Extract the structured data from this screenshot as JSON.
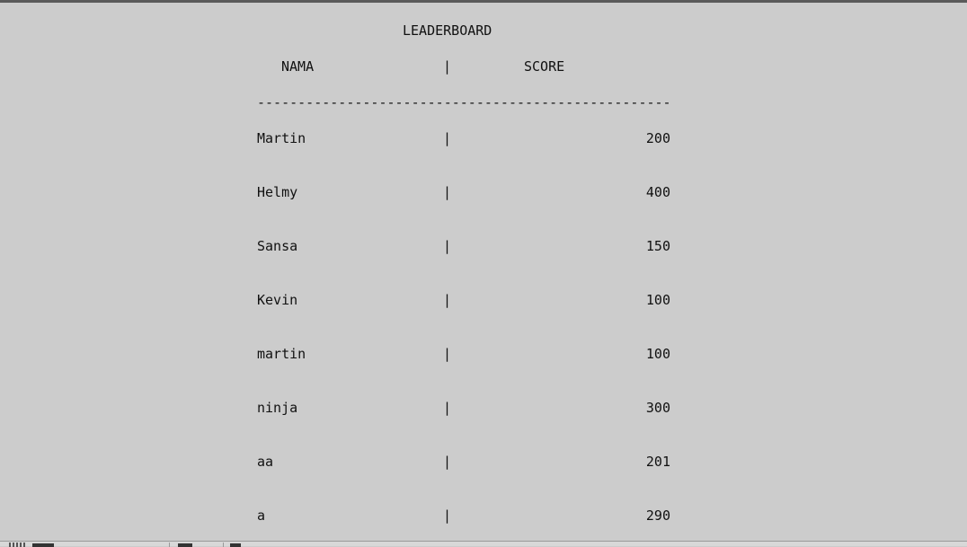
{
  "leaderboard": {
    "title": "LEADERBOARD",
    "header": {
      "name": "NAMA",
      "separator": "|",
      "score": "SCORE"
    },
    "divider": "---------------------------------------------------",
    "rows": [
      {
        "name": "Martin",
        "separator": "|",
        "score": "200"
      },
      {
        "name": "Helmy",
        "separator": "|",
        "score": "400"
      },
      {
        "name": "Sansa",
        "separator": "|",
        "score": "150"
      },
      {
        "name": "Kevin",
        "separator": "|",
        "score": "100"
      },
      {
        "name": "martin",
        "separator": "|",
        "score": "100"
      },
      {
        "name": "ninja",
        "separator": "|",
        "score": "300"
      },
      {
        "name": "aa",
        "separator": "|",
        "score": "201"
      },
      {
        "name": "a",
        "separator": "|",
        "score": "290"
      }
    ]
  }
}
